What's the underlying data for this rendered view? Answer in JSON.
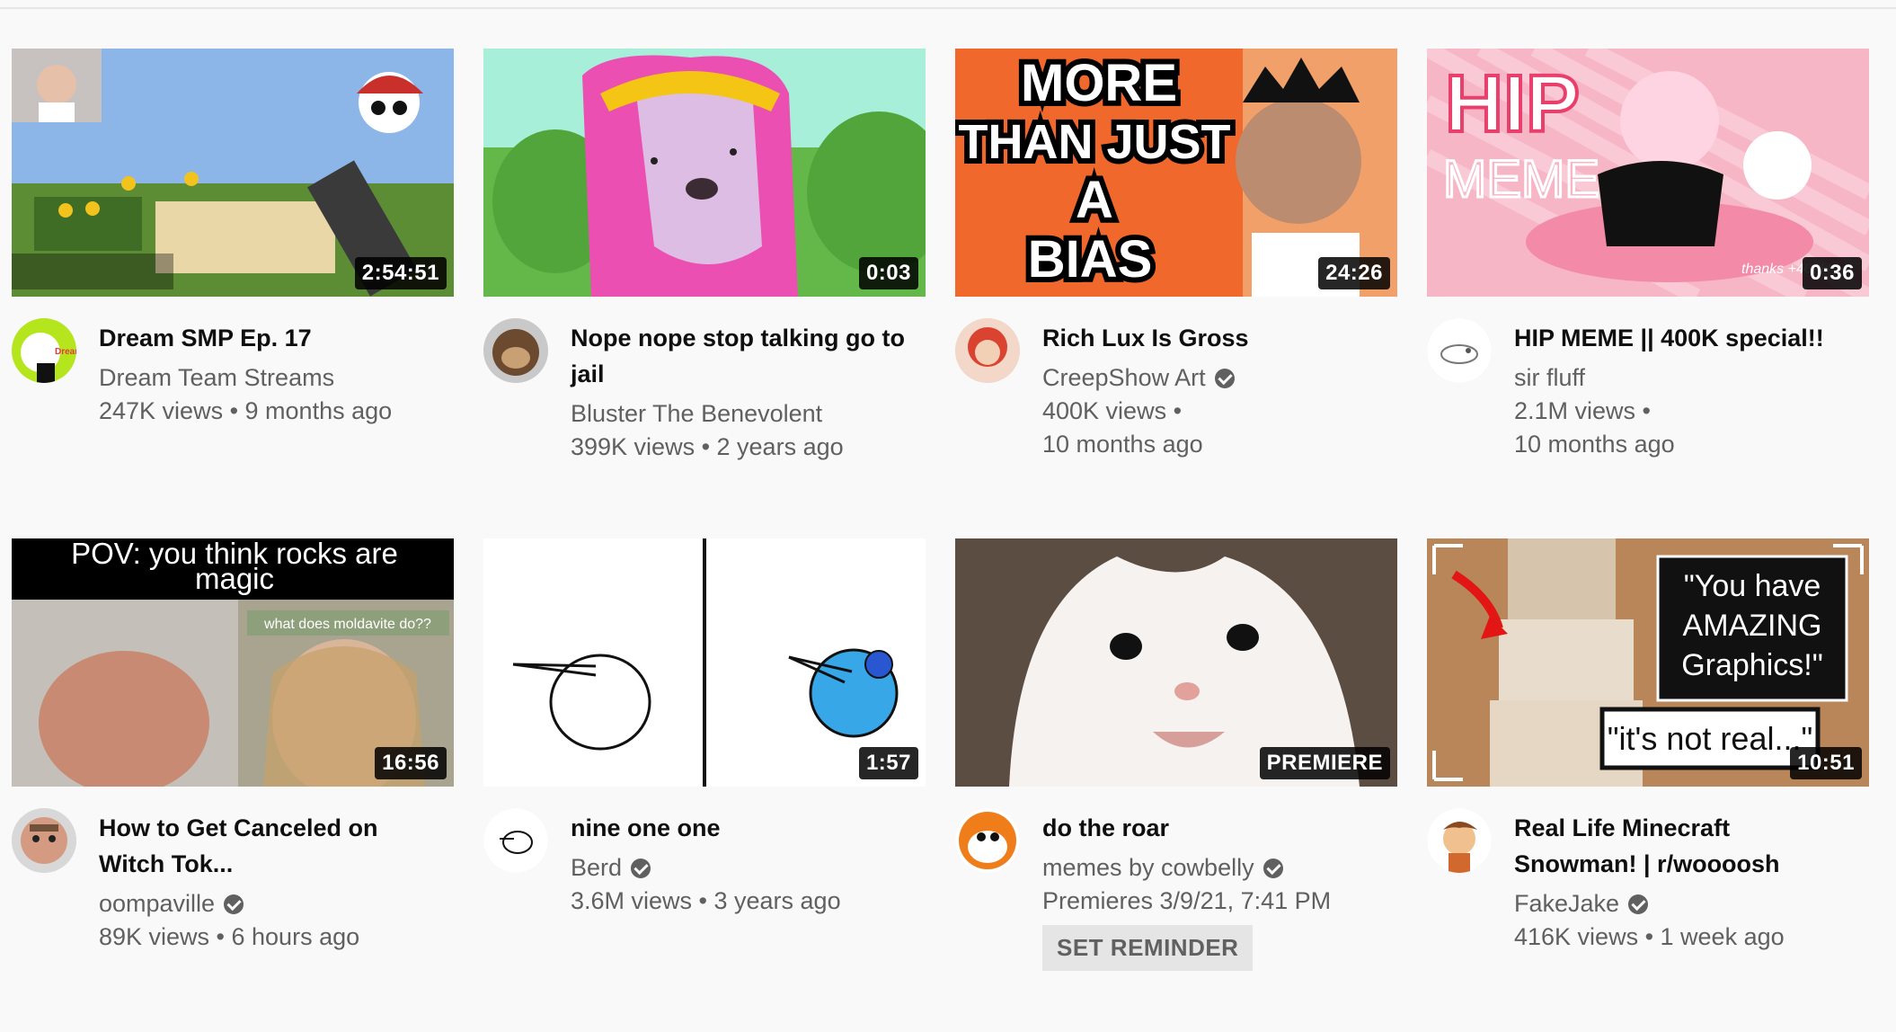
{
  "videos": [
    {
      "title": "Dream SMP Ep. 17",
      "channel": "Dream Team Streams",
      "verified": false,
      "stats": "247K views • 9 months ago",
      "duration": "2:54:51"
    },
    {
      "title": "Nope nope stop talking go to jail",
      "channel": "Bluster The Benevolent",
      "verified": false,
      "stats": "399K views • 2 years ago",
      "duration": "0:03"
    },
    {
      "title": "Rich Lux Is Gross",
      "channel": "CreepShow Art",
      "verified": true,
      "stats": "400K views •",
      "stats2": "10 months ago",
      "duration": "24:26",
      "thumb_text": [
        "MORE",
        "THAN JUST",
        "A",
        "BIAS"
      ]
    },
    {
      "title": "HIP MEME || 400K special!!",
      "channel": "sir fluff",
      "verified": false,
      "stats": "2.1M views •",
      "stats2": "10 months ago",
      "duration": "0:36",
      "thumb_text": [
        "HIP",
        "MEME"
      ],
      "thumb_small": "thanks +400k!"
    },
    {
      "title": "How to Get Canceled on Witch Tok...",
      "channel": "oompaville",
      "verified": true,
      "stats": "89K views • 6 hours ago",
      "duration": "16:56",
      "thumb_text": [
        "POV: you think rocks are",
        "magic"
      ],
      "thumb_small": "what does moldavite do??"
    },
    {
      "title": "nine one one",
      "channel": "Berd",
      "verified": true,
      "stats": "3.6M views • 3 years ago",
      "duration": "1:57"
    },
    {
      "title": "do the roar",
      "channel": "memes by cowbelly",
      "verified": true,
      "stats": "Premieres 3/9/21, 7:41 PM",
      "duration": "PREMIERE",
      "button": "SET REMINDER"
    },
    {
      "title": "Real Life Minecraft Snowman! | r/woooosh",
      "channel": "FakeJake",
      "verified": true,
      "stats": "416K views • 1 week ago",
      "duration": "10:51",
      "thumb_text": [
        "\"You have",
        "AMAZING",
        "Graphics!\""
      ],
      "thumb_small": "\"it's not real...\""
    }
  ],
  "avatar_text": {
    "dream": "Dream"
  }
}
